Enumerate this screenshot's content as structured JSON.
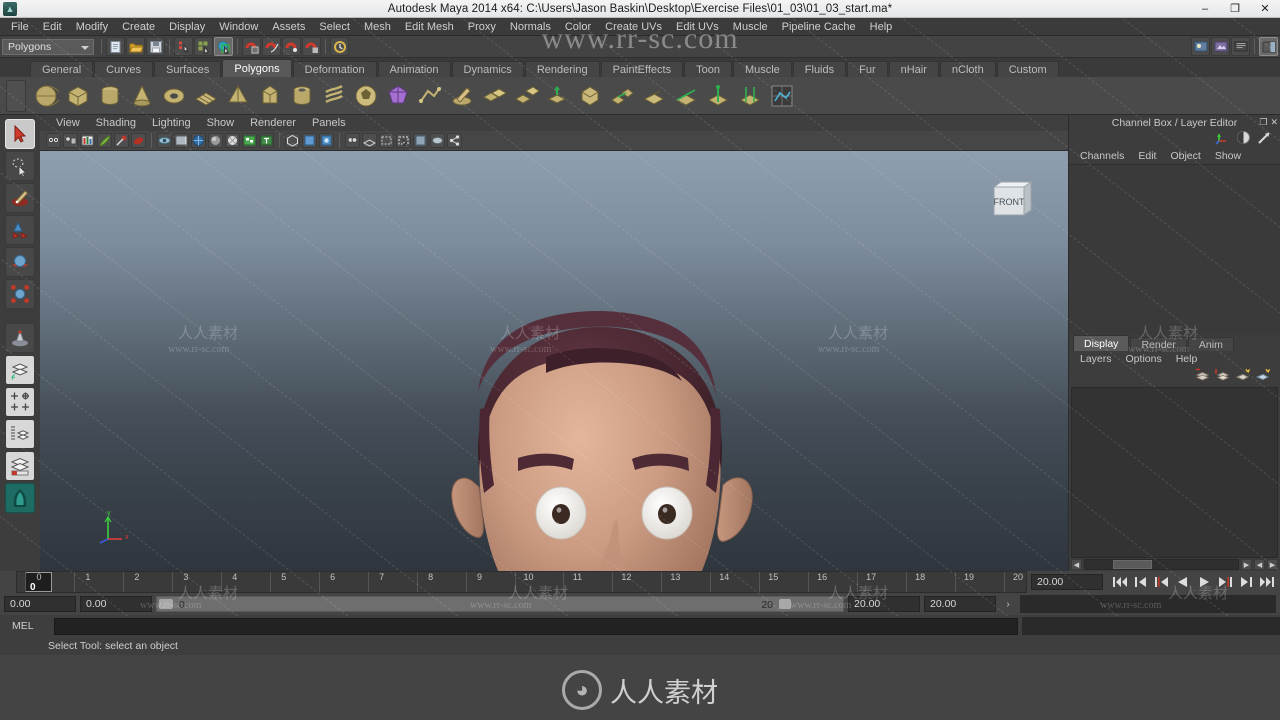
{
  "titlebar": {
    "title": "Autodesk Maya 2014 x64: C:\\Users\\Jason Baskin\\Desktop\\Exercise Files\\01_03\\01_03_start.ma*",
    "minimize": "–",
    "maximize": "❐",
    "close": "✕"
  },
  "menubar": {
    "items": [
      "File",
      "Edit",
      "Modify",
      "Create",
      "Display",
      "Window",
      "Assets",
      "Select",
      "Mesh",
      "Edit Mesh",
      "Proxy",
      "Normals",
      "Color",
      "Create UVs",
      "Edit UVs",
      "Muscle",
      "Pipeline Cache",
      "Help"
    ]
  },
  "statusline": {
    "mode": "Polygons"
  },
  "shelf": {
    "tabs": [
      "General",
      "Curves",
      "Surfaces",
      "Polygons",
      "Deformation",
      "Animation",
      "Dynamics",
      "Rendering",
      "PaintEffects",
      "Toon",
      "Muscle",
      "Fluids",
      "Fur",
      "nHair",
      "nCloth",
      "Custom"
    ],
    "active_tab": "Polygons"
  },
  "viewport": {
    "menus": [
      "View",
      "Shading",
      "Lighting",
      "Show",
      "Renderer",
      "Panels"
    ],
    "viewcube_label": "FRONT",
    "axis_x": "x",
    "axis_y": "y",
    "axis_z": "z"
  },
  "channelbox": {
    "title": "Channel Box / Layer Editor",
    "menus": [
      "Channels",
      "Edit",
      "Object",
      "Show"
    ]
  },
  "layereditor": {
    "tabs": [
      "Display",
      "Render",
      "Anim"
    ],
    "active_tab": "Display",
    "menus": [
      "Layers",
      "Options",
      "Help"
    ]
  },
  "timeline": {
    "current_frame": "0",
    "end_field": "20.00",
    "ticks": [
      "0",
      "1",
      "2",
      "3",
      "4",
      "5",
      "6",
      "7",
      "8",
      "9",
      "10",
      "11",
      "12",
      "13",
      "14",
      "15",
      "16",
      "17",
      "18",
      "19",
      "20"
    ],
    "start": 0,
    "end": 20
  },
  "rangeslider": {
    "anim_start": "0.00",
    "anim_end": "0.00",
    "range_start_label": "0",
    "range_end_label": "20",
    "playback_end": "20.00",
    "anim_end2": "20.00"
  },
  "melline": {
    "label": "MEL",
    "value": ""
  },
  "statusbar": {
    "message": "Select Tool: select an object"
  },
  "watermarks": {
    "url_big": "www.rr-sc.com",
    "cn": "人人素材",
    "url_small": "www.rr-sc.com",
    "center_text": "人人素材"
  },
  "colors": {
    "skin": "#c99a82",
    "hair": "#4c2932",
    "mustache": "#5d2f3c",
    "eye_white": "#f2f0ec",
    "pupil": "#3a2a22",
    "accent_red": "#c0392b",
    "viewport_top": "#8f9fb0",
    "viewport_bottom": "#2f363d"
  }
}
